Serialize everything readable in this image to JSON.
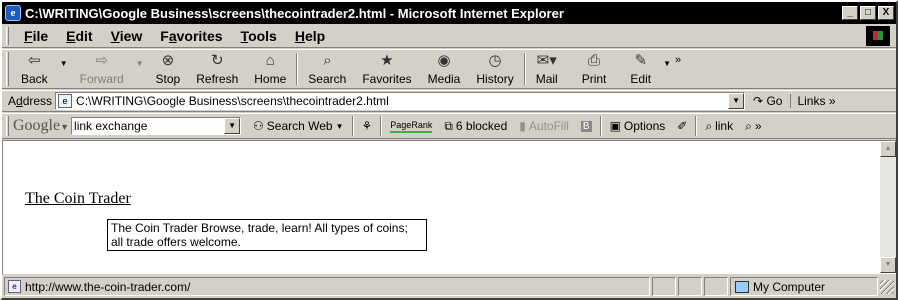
{
  "window": {
    "title": "C:\\WRITING\\Google Business\\screens\\thecointrader2.html - Microsoft Internet Explorer",
    "controls": [
      "_",
      "□",
      "X"
    ]
  },
  "menu": {
    "items": [
      {
        "pre": "",
        "key": "F",
        "post": "ile"
      },
      {
        "pre": "",
        "key": "E",
        "post": "dit"
      },
      {
        "pre": "",
        "key": "V",
        "post": "iew"
      },
      {
        "pre": "F",
        "key": "a",
        "post": "vorites"
      },
      {
        "pre": "",
        "key": "T",
        "post": "ools"
      },
      {
        "pre": "",
        "key": "H",
        "post": "elp"
      }
    ]
  },
  "toolbar": {
    "back": "Back",
    "forward": "Forward",
    "stop": "Stop",
    "refresh": "Refresh",
    "home": "Home",
    "search": "Search",
    "favorites": "Favorites",
    "media": "Media",
    "history": "History",
    "mail": "Mail",
    "print": "Print",
    "edit": "Edit",
    "more": "»"
  },
  "address": {
    "label_pre": "A",
    "label_key": "d",
    "label_post": "dress",
    "value": "C:\\WRITING\\Google Business\\screens\\thecointrader2.html",
    "go": "Go",
    "links": "Links »"
  },
  "googlebar": {
    "logo": "Google",
    "search_value": "link exchange",
    "search_web": "Search Web",
    "pagerank": "PageRank",
    "blocked": "6 blocked",
    "autofill": "AutoFill",
    "options": "Options",
    "link": "link"
  },
  "content": {
    "result_title": "The Coin Trader",
    "tooltip": "The Coin Trader Browse, trade, learn! All types of coins; all trade offers welcome."
  },
  "status": {
    "url": "http://www.the-coin-trader.com/",
    "zone": "My Computer"
  },
  "colors": {
    "chrome": "#d4d0c8",
    "titlebar": "#000000",
    "content_bg": "#ffffff"
  }
}
